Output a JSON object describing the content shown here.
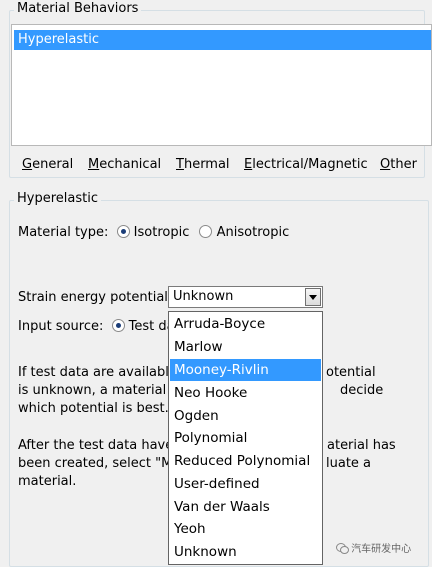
{
  "material_behaviors": {
    "title": "Material Behaviors",
    "items": [
      "Hyperelastic"
    ],
    "selected": "Hyperelastic"
  },
  "menu": {
    "general": {
      "ul": "G",
      "rest": "eneral"
    },
    "mechanical": {
      "ul": "M",
      "rest": "echanical"
    },
    "thermal": {
      "ul": "T",
      "rest": "hermal"
    },
    "electrical": {
      "ul": "E",
      "rest": "lectrical/Magnetic"
    },
    "other": {
      "ul": "O",
      "rest": "ther"
    }
  },
  "hyperelastic": {
    "title": "Hyperelastic",
    "material_type_label": "Material type:",
    "isotropic_label": "Isotropic",
    "anisotropic_label": "Anisotropic",
    "strain_label": "Strain energy potential:",
    "strain_value": "Unknown",
    "input_source_label": "Input source:",
    "test_data_label": "Test da",
    "para1_line1_a": "If test data are available",
    "para1_line1_b": "otential",
    "para1_line2_a": "is unknown, a material r",
    "para1_line2_b": "decide",
    "para1_line3": "which potential is best.",
    "para2_line1_a": "After the test data have",
    "para2_line1_b": "aterial has",
    "para2_line2_a": "been created, select \"M",
    "para2_line2_b": "luate a",
    "para2_line3": "material."
  },
  "dropdown": {
    "options": [
      "Arruda-Boyce",
      "Marlow",
      "Mooney-Rivlin",
      "Neo Hooke",
      "Ogden",
      "Polynomial",
      "Reduced Polynomial",
      "User-defined",
      "Van der Waals",
      "Yeoh",
      "Unknown"
    ],
    "highlighted": "Mooney-Rivlin"
  },
  "watermark": {
    "text": "汽车研发中心"
  }
}
